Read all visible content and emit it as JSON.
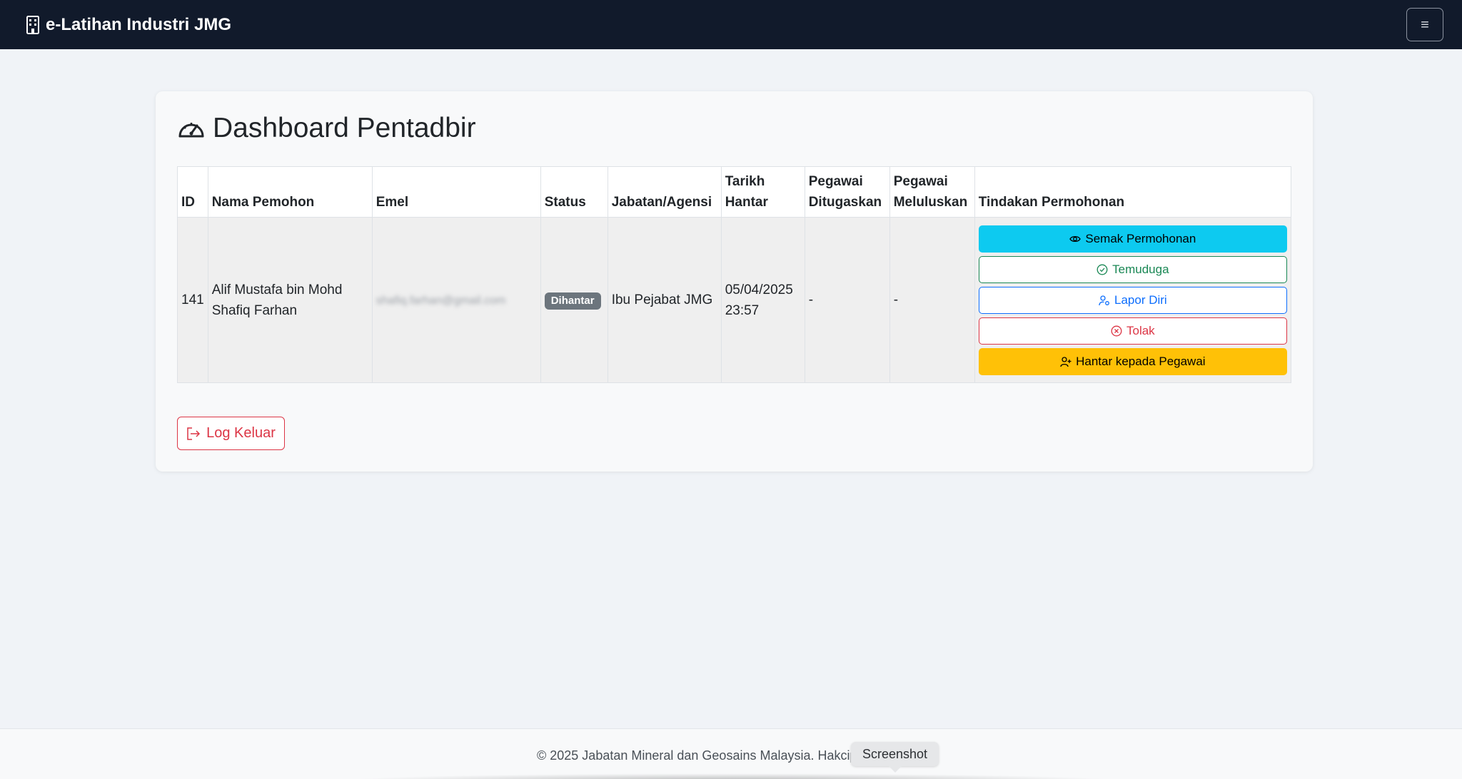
{
  "navbar": {
    "brand": "e-Latihan Industri JMG",
    "brand_icon": "building-icon",
    "toggler_icon": "menu-icon",
    "toggler_glyph": "≡"
  },
  "page": {
    "title": "Dashboard Pentadbir",
    "title_icon": "speedometer-icon"
  },
  "table": {
    "headers": {
      "id": "ID",
      "name": "Nama Pemohon",
      "email": "Emel",
      "status": "Status",
      "agency": "Jabatan/Agensi",
      "date": "Tarikh Hantar",
      "assigned": "Pegawai Ditugaskan",
      "approved": "Pegawai Meluluskan",
      "actions": "Tindakan Permohonan"
    },
    "rows": [
      {
        "id": "141",
        "name": "Alif Mustafa bin Mohd Shafiq Farhan",
        "email": "shafiq.farhan@gmail.com",
        "status": "Dihantar",
        "agency": "Ibu Pejabat JMG",
        "date": "05/04/2025 23:57",
        "assigned": "-",
        "approved": "-",
        "actions": {
          "review": "Semak Permohonan",
          "interview": "Temuduga",
          "report": "Lapor Diri",
          "reject": "Tolak",
          "send": "Hantar kepada Pegawai"
        }
      }
    ]
  },
  "logout": {
    "label": "Log Keluar"
  },
  "footer": {
    "text": "© 2025 Jabatan Mineral dan Geosains Malaysia. Hakcipta Terpelihara.",
    "tooltip": "Screenshot"
  },
  "colors": {
    "navbar": "#111a2b",
    "info": "#0dcaf0",
    "success": "#198754",
    "primary": "#0d6efd",
    "danger": "#dc3545",
    "warning": "#ffc107",
    "badge": "#6c757d"
  }
}
